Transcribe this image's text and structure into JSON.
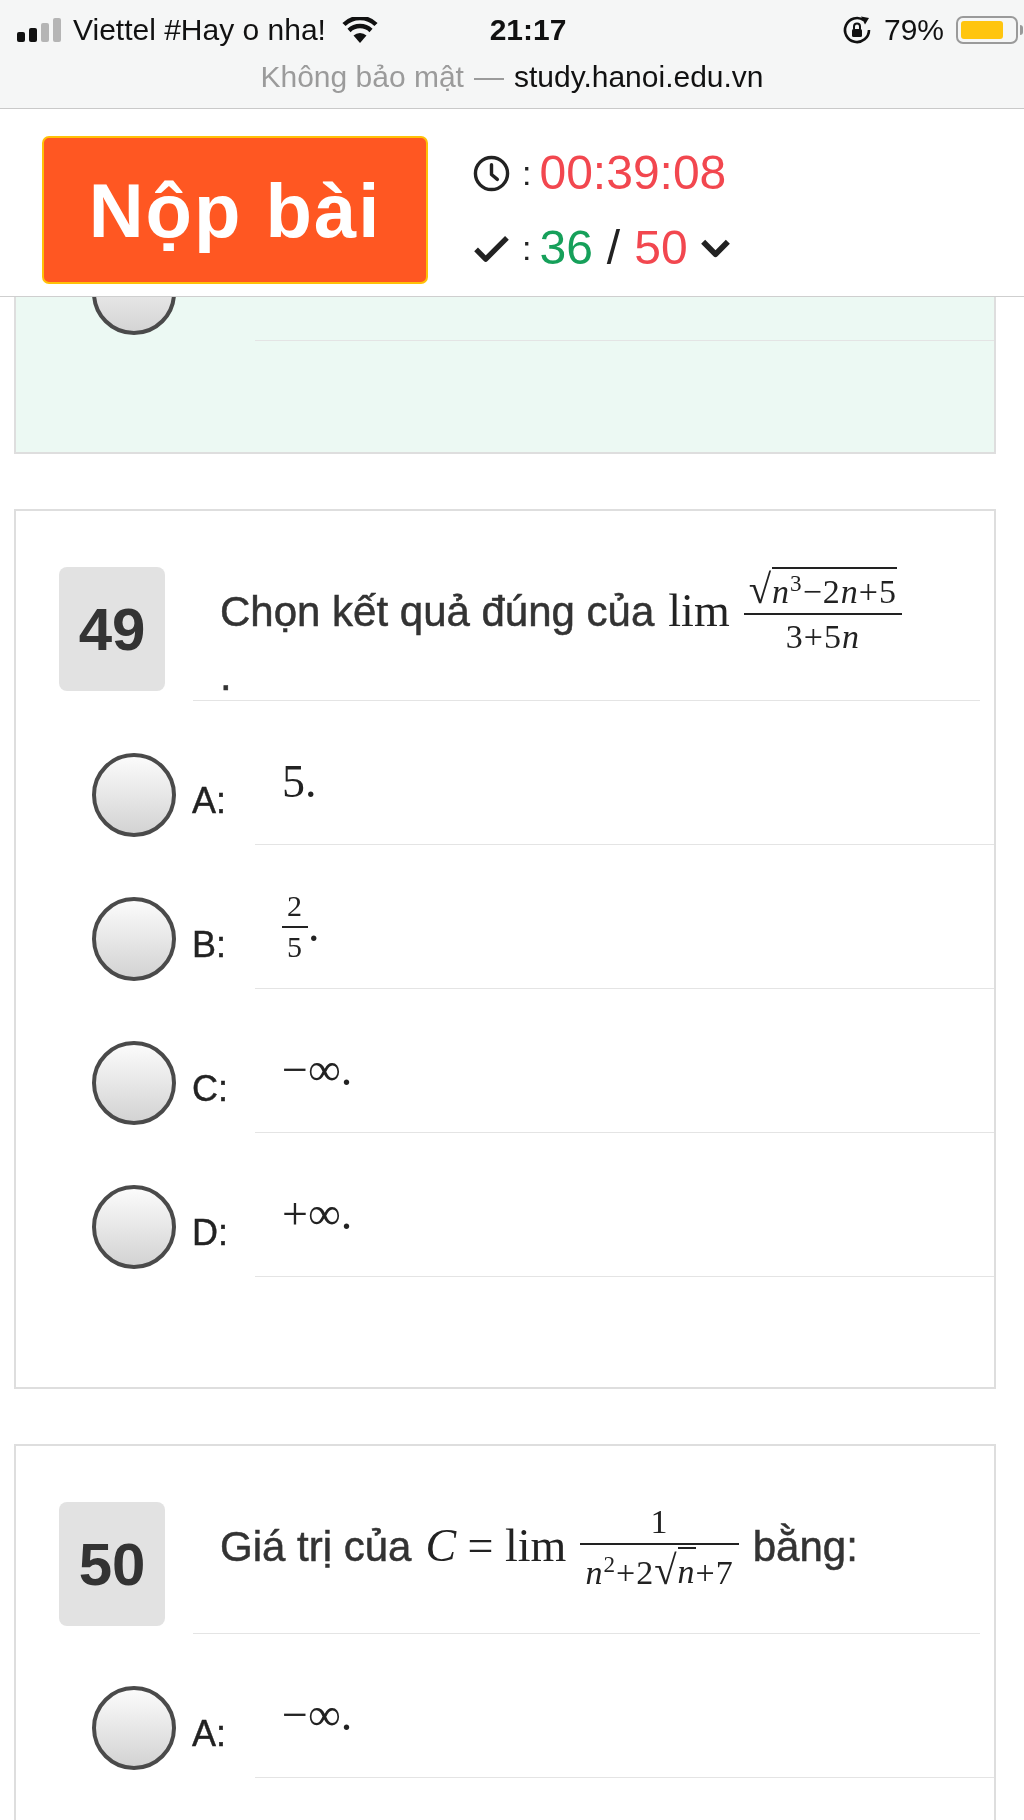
{
  "status_bar": {
    "carrier": "Viettel #Hay o nha!",
    "time": "21:17",
    "battery_percent": "79%"
  },
  "address_bar": {
    "security_label": "Không bảo mật",
    "separator": "—",
    "url": "study.hanoi.edu.vn"
  },
  "toolbar": {
    "submit_button": "Nộp bài",
    "timer": {
      "prefix": ":",
      "value": "00:39:08"
    },
    "progress": {
      "prefix": ":",
      "answered": "36",
      "separator": "/",
      "total": "50"
    }
  },
  "previous_question": {
    "answered": true,
    "options": [
      {
        "selected": false
      }
    ]
  },
  "questions": [
    {
      "number": "49",
      "answered": false,
      "prompt_lines": [
        [
          {
            "kind": "text",
            "text": "Chọn kết quả đúng của"
          },
          {
            "kind": "math",
            "text": "lim"
          },
          {
            "kind": "frac",
            "num": [
              {
                "kind": "sqrt",
                "sign": "√",
                "body": [
                  {
                    "kind": "math",
                    "text": "*n*$^{3}$−2"
                  },
                  {
                    "kind": "math",
                    "text": "*n*"
                  },
                  {
                    "kind": "math",
                    "text": "+5"
                  }
                ]
              }
            ],
            "den": [
              {
                "kind": "math",
                "text": "3+5"
              },
              {
                "kind": "math",
                "text": "*n*"
              }
            ]
          }
        ],
        [
          {
            "kind": "text",
            "text": "."
          }
        ]
      ],
      "options": [
        {
          "label": "A:",
          "selected": false,
          "value": [
            {
              "kind": "math",
              "text": "5."
            }
          ]
        },
        {
          "label": "B:",
          "selected": false,
          "value": [
            {
              "kind": "frac",
              "num": [
                {
                  "kind": "math",
                  "text": "2"
                }
              ],
              "den": [
                {
                  "kind": "math",
                  "text": "5"
                }
              ]
            },
            {
              "kind": "math",
              "text": "."
            }
          ]
        },
        {
          "label": "C:",
          "selected": false,
          "value": [
            {
              "kind": "math",
              "text": "−∞."
            }
          ]
        },
        {
          "label": "D:",
          "selected": false,
          "value": [
            {
              "kind": "math",
              "text": "+∞."
            }
          ]
        }
      ]
    },
    {
      "number": "50",
      "answered": false,
      "prompt_lines": [
        [
          {
            "kind": "text",
            "text": "Giá trị của"
          },
          {
            "kind": "math",
            "text": "*C* = lim"
          },
          {
            "kind": "frac",
            "num": [
              {
                "kind": "math",
                "text": "1"
              }
            ],
            "den": [
              {
                "kind": "math",
                "text": "*n*$^{2}$+2"
              },
              {
                "kind": "sqrt",
                "sign": "√",
                "body": [
                  {
                    "kind": "math",
                    "text": "*n*"
                  }
                ]
              },
              {
                "kind": "math",
                "text": "+7"
              }
            ]
          },
          {
            "kind": "text",
            "text": "bằng:"
          }
        ]
      ],
      "options": [
        {
          "label": "A:",
          "selected": false,
          "value": [
            {
              "kind": "math",
              "text": "−∞."
            }
          ]
        }
      ]
    }
  ]
}
